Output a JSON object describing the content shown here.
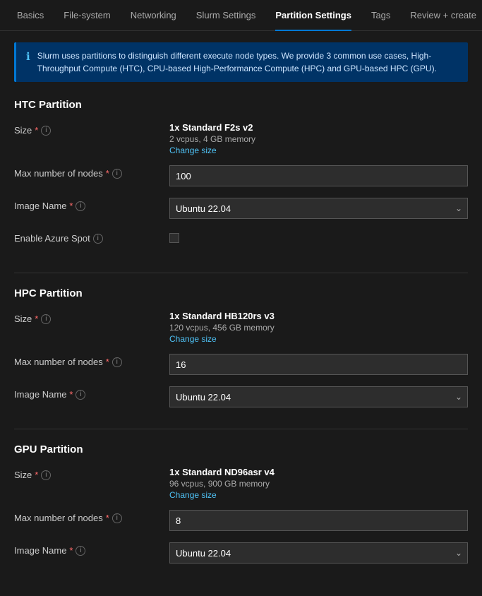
{
  "nav": {
    "items": [
      {
        "label": "Basics",
        "active": false
      },
      {
        "label": "File-system",
        "active": false
      },
      {
        "label": "Networking",
        "active": false
      },
      {
        "label": "Slurm Settings",
        "active": false
      },
      {
        "label": "Partition Settings",
        "active": true
      },
      {
        "label": "Tags",
        "active": false
      },
      {
        "label": "Review + create",
        "active": false
      }
    ]
  },
  "info_banner": {
    "text": "Slurm uses partitions to distinguish different execute node types. We provide 3 common use cases, High-Throughput Compute (HTC), CPU-based High-Performance Compute (HPC) and GPU-based HPC (GPU)."
  },
  "htc_partition": {
    "title": "HTC Partition",
    "size_label": "Size",
    "size_name": "1x Standard F2s v2",
    "size_specs": "2 vcpus, 4 GB memory",
    "change_size": "Change size",
    "max_nodes_label": "Max number of nodes",
    "max_nodes_value": "100",
    "image_label": "Image Name",
    "image_value": "Ubuntu 22.04",
    "azure_spot_label": "Enable Azure Spot"
  },
  "hpc_partition": {
    "title": "HPC Partition",
    "size_label": "Size",
    "size_name": "1x Standard HB120rs v3",
    "size_specs": "120 vcpus, 456 GB memory",
    "change_size": "Change size",
    "max_nodes_label": "Max number of nodes",
    "max_nodes_value": "16",
    "image_label": "Image Name",
    "image_value": "Ubuntu 22.04"
  },
  "gpu_partition": {
    "title": "GPU Partition",
    "size_label": "Size",
    "size_name": "1x Standard ND96asr v4",
    "size_specs": "96 vcpus, 900 GB memory",
    "change_size": "Change size",
    "max_nodes_label": "Max number of nodes",
    "max_nodes_value": "8",
    "image_label": "Image Name",
    "image_value": "Ubuntu 22.04"
  },
  "icons": {
    "info": "ℹ",
    "chevron_down": "⌄",
    "required": "*",
    "info_circle": "i"
  }
}
